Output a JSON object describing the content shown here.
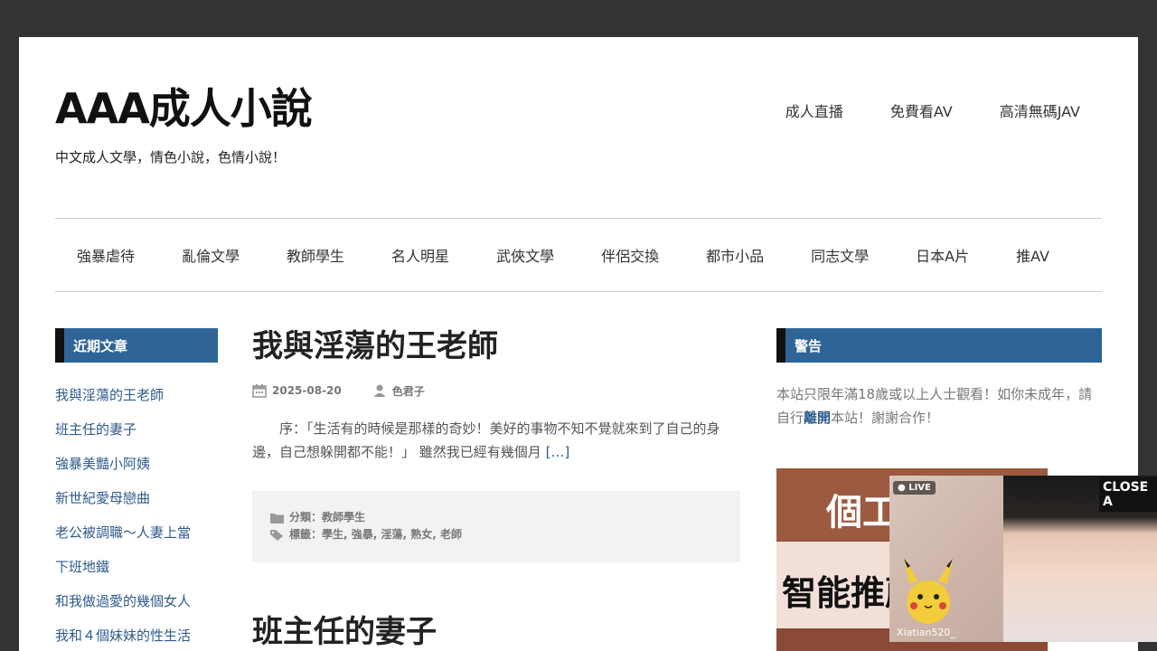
{
  "header": {
    "site_title": "AAA成人小說",
    "site_description": "中文成人文學，情色小說，色情小說！",
    "top_nav": [
      "成人直播",
      "免費看AV",
      "高清無碼JAV"
    ]
  },
  "main_nav": [
    "強暴虐待",
    "亂倫文學",
    "教師學生",
    "名人明星",
    "武俠文學",
    "伴侶交換",
    "都市小品",
    "同志文學",
    "日本A片",
    "推AV"
  ],
  "sidebar_left": {
    "title": "近期文章",
    "items": [
      "我與淫蕩的王老師",
      "班主任的妻子",
      "強暴美豔小阿姨",
      "新世紀愛母戀曲",
      "老公被調職～人妻上當",
      "下班地鐵",
      "和我做過愛的幾個女人",
      "我和４個妹妹的性生活"
    ]
  },
  "posts": [
    {
      "title": "我與淫蕩的王老師",
      "date": "2025-08-20",
      "author": "色君子",
      "excerpt": "序：「生活有的時候是那樣的奇妙！美好的事物不知不覺就來到了自己的身邊，自己想躲開都不能！」 雖然我已經有幾個月",
      "more": "[…]",
      "category_line": "分類：教師學生",
      "tags_line": "標籤：學生, 強暴, 淫蕩, 熟女, 老師"
    },
    {
      "title": "班主任的妻子"
    }
  ],
  "sidebar_right": {
    "title": "警告",
    "text_before": "本站只限年滿18歲或以上人士觀看！如你未成年，請自行",
    "text_link": "離開",
    "text_after": "本站！謝謝合作！"
  },
  "ads": {
    "banner_line1": "個工",
    "banner_line2": "智能推薦",
    "live_badge": "● LIVE",
    "live_username": "Xiatian520_",
    "close_label": "CLOSE A"
  },
  "colors": {
    "accent": "#2e6496",
    "link": "#2e5b8c",
    "frame": "#333333"
  }
}
